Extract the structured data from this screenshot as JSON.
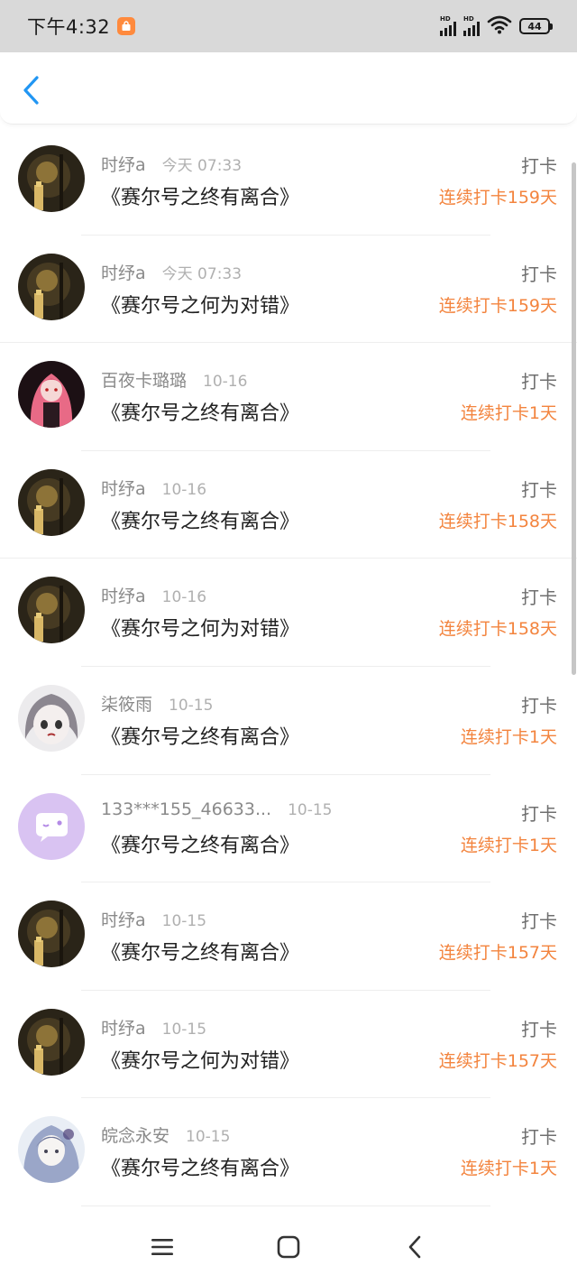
{
  "status_bar": {
    "time": "下午4:32",
    "battery": "44"
  },
  "header": {
    "back_icon": "chevron-left-icon"
  },
  "rows": [
    {
      "name": "时纾a",
      "time": "今天 07:33",
      "title": "《赛尔号之终有离合》",
      "action": "打卡",
      "streak": "连续打卡159天",
      "avatar": "dark-scene"
    },
    {
      "name": "时纾a",
      "time": "今天 07:33",
      "title": "《赛尔号之何为对错》",
      "action": "打卡",
      "streak": "连续打卡159天",
      "avatar": "dark-scene"
    },
    {
      "name": "百夜卡璐璐",
      "time": "10-16",
      "title": "《赛尔号之终有离合》",
      "action": "打卡",
      "streak": "连续打卡1天",
      "avatar": "pink-anime"
    },
    {
      "name": "时纾a",
      "time": "10-16",
      "title": "《赛尔号之终有离合》",
      "action": "打卡",
      "streak": "连续打卡158天",
      "avatar": "dark-scene"
    },
    {
      "name": "时纾a",
      "time": "10-16",
      "title": "《赛尔号之何为对错》",
      "action": "打卡",
      "streak": "连续打卡158天",
      "avatar": "dark-scene"
    },
    {
      "name": "柒筱雨",
      "time": "10-15",
      "title": "《赛尔号之终有离合》",
      "action": "打卡",
      "streak": "连续打卡1天",
      "avatar": "grey-anime"
    },
    {
      "name": "133***155_46633...",
      "time": "10-15",
      "title": "《赛尔号之终有离合》",
      "action": "打卡",
      "streak": "连续打卡1天",
      "avatar": "purple-default"
    },
    {
      "name": "时纾a",
      "time": "10-15",
      "title": "《赛尔号之终有离合》",
      "action": "打卡",
      "streak": "连续打卡157天",
      "avatar": "dark-scene"
    },
    {
      "name": "时纾a",
      "time": "10-15",
      "title": "《赛尔号之何为对错》",
      "action": "打卡",
      "streak": "连续打卡157天",
      "avatar": "dark-scene"
    },
    {
      "name": "皖念永安",
      "time": "10-15",
      "title": "《赛尔号之终有离合》",
      "action": "打卡",
      "streak": "连续打卡1天",
      "avatar": "blue-anime"
    }
  ],
  "colors": {
    "accent": "#f3843e",
    "back": "#2196f3",
    "status_bg": "#d9d9d9"
  },
  "navbar": {
    "icons": [
      "menu-icon",
      "home-square-icon",
      "back-triangle-icon"
    ]
  }
}
